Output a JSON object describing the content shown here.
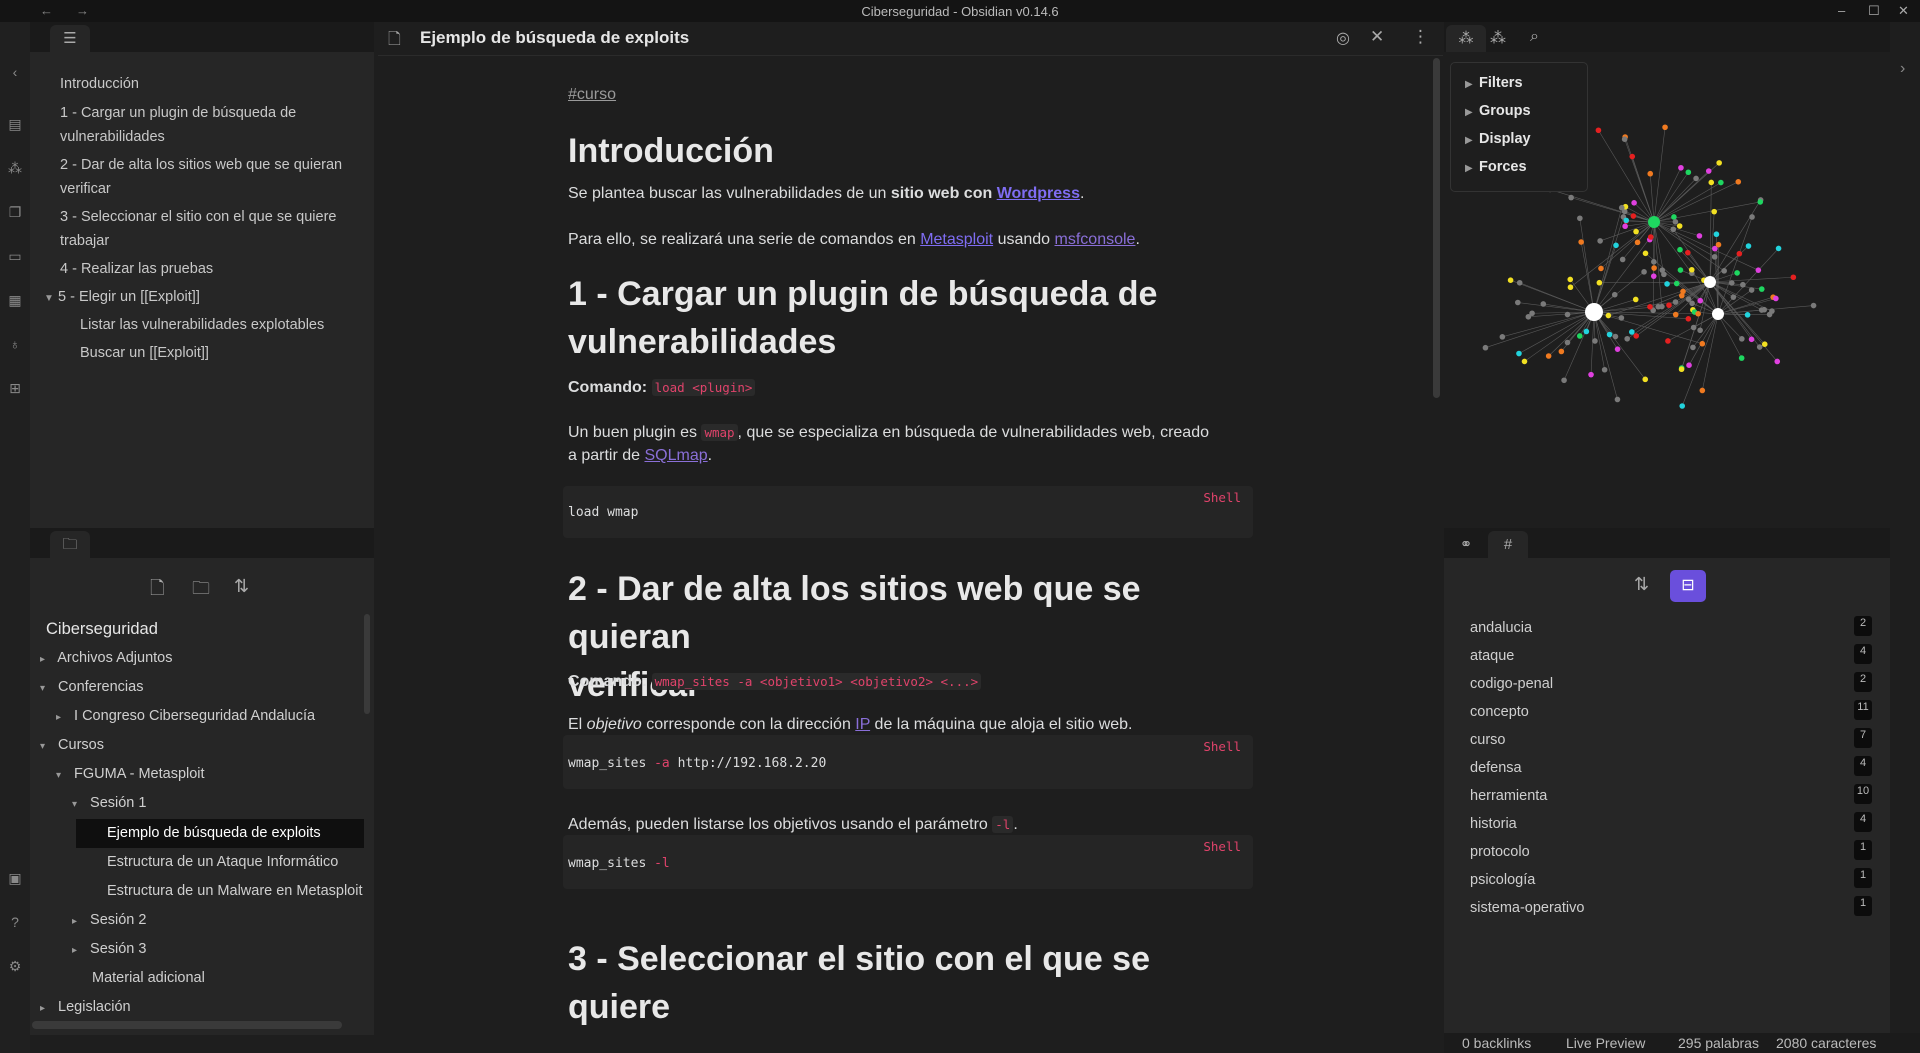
{
  "window": {
    "title": "Ciberseguridad - Obsidian v0.14.6",
    "controls": [
      "–",
      "☐",
      "✕"
    ]
  },
  "ribbon": {
    "icons": [
      "chevron-left-icon",
      "file-icon",
      "graph-icon",
      "copy-icon",
      "folder-stack-icon",
      "grid-icon",
      "mic-icon",
      "table-icon",
      "vault-icon",
      "help-icon",
      "settings-icon"
    ]
  },
  "outline": {
    "items": [
      {
        "text": "Introducción"
      },
      {
        "text": "1 - Cargar un plugin de búsqueda de"
      },
      {
        "text": "vulnerabilidades"
      },
      {
        "text": "2 - Dar de alta los sitios web que se quieran"
      },
      {
        "text": "verificar"
      },
      {
        "text": "3 - Seleccionar el sitio con el que se quiere"
      },
      {
        "text": "trabajar"
      },
      {
        "text": "4 - Realizar las pruebas"
      },
      {
        "text": "5 - Elegir un [[Exploit]]"
      },
      {
        "text": "Listar las vulnerabilidades explotables"
      },
      {
        "text": "Buscar un [[Exploit]]"
      }
    ]
  },
  "explorer": {
    "vault": "Ciberseguridad",
    "items": [
      {
        "text": "Archivos Adjuntos",
        "arrow": "▸"
      },
      {
        "text": "Conferencias",
        "arrow": "▾"
      },
      {
        "text": "I Congreso Ciberseguridad Andalucía",
        "arrow": "▸"
      },
      {
        "text": "Cursos",
        "arrow": "▾"
      },
      {
        "text": "FGUMA - Metasploit",
        "arrow": "▾"
      },
      {
        "text": "Sesión 1",
        "arrow": "▾"
      },
      {
        "text": "Ejemplo de búsqueda de exploits",
        "arrow": ""
      },
      {
        "text": "Estructura de un Ataque Informático",
        "arrow": ""
      },
      {
        "text": "Estructura de un Malware en Metasploit",
        "arrow": ""
      },
      {
        "text": "Sesión 2",
        "arrow": "▸"
      },
      {
        "text": "Sesión 3",
        "arrow": "▸"
      },
      {
        "text": "Material adicional",
        "arrow": ""
      },
      {
        "text": "Legislación",
        "arrow": "▸"
      }
    ]
  },
  "editor": {
    "title": "Ejemplo de búsqueda de exploits",
    "tag": "#curso",
    "h_intro": "Introducción",
    "p1_a": "Se plantea buscar las vulnerabilidades de un ",
    "p1_b": "sitio web con ",
    "p1_link": "Wordpress",
    "p1_end": ".",
    "p2_a": "Para ello, se realizará una serie de comandos en ",
    "p2_link1": "Metasploit",
    "p2_mid": " usando ",
    "p2_link2": "msfconsole",
    "p2_end": ".",
    "h1_line1": "1 - Cargar un plugin de búsqueda de",
    "h1_line2": "vulnerabilidades",
    "cmd_label": "Comando:",
    "cmd1": "load <plugin>",
    "p3_a": "Un buen plugin es ",
    "p3_code": "wmap",
    "p3_b": ", que se especializa en búsqueda de vulnerabilidades web, creado",
    "p3_c": "a partir de ",
    "p3_link": "SQLmap",
    "p3_end": ".",
    "code_lang": "Shell",
    "code1": "load wmap",
    "h2_line1": "2 - Dar de alta los sitios web que se quieran",
    "h2_line2": "verificar",
    "cmd2": "wmap_sites -a <objetivo1> <objetivo2> <...>",
    "p4_a": "El ",
    "p4_em": "objetivo",
    "p4_b": " corresponde con la dirección ",
    "p4_link": "IP",
    "p4_c": " de la máquina que aloja el sitio web.",
    "code2_a": "wmap_sites ",
    "code2_flag": "-a",
    "code2_b": " http://192.168.2.20",
    "p5_a": "Además, pueden listarse los objetivos usando el parámetro ",
    "p5_code": "-l",
    "p5_end": ".",
    "code3_a": "wmap_sites ",
    "code3_flag": "-l",
    "h3_line1": "3 - Seleccionar el sitio con el que se quiere",
    "h3_line2": "trabajar"
  },
  "graph": {
    "filters": [
      "Filters",
      "Groups",
      "Display",
      "Forces"
    ],
    "node_colors": {
      "default": "#7a7a7a",
      "hub": "#ffffff",
      "green": "#1ed760",
      "magenta": "#e040e0",
      "cyan": "#22d3dd",
      "yellow": "#f2e022",
      "red": "#e52020",
      "orange": "#f07a20"
    }
  },
  "tags": {
    "items": [
      {
        "name": "andalucia",
        "count": "2"
      },
      {
        "name": "ataque",
        "count": "4"
      },
      {
        "name": "codigo-penal",
        "count": "2"
      },
      {
        "name": "concepto",
        "count": "11"
      },
      {
        "name": "curso",
        "count": "7"
      },
      {
        "name": "defensa",
        "count": "4"
      },
      {
        "name": "herramienta",
        "count": "10"
      },
      {
        "name": "historia",
        "count": "4"
      },
      {
        "name": "protocolo",
        "count": "1"
      },
      {
        "name": "psicología",
        "count": "1"
      },
      {
        "name": "sistema-operativo",
        "count": "1"
      }
    ]
  },
  "status": {
    "backlinks": "0 backlinks",
    "mode": "Live Preview",
    "words": "295 palabras",
    "chars": "2080 caracteres"
  },
  "accent": "#7f6df2"
}
